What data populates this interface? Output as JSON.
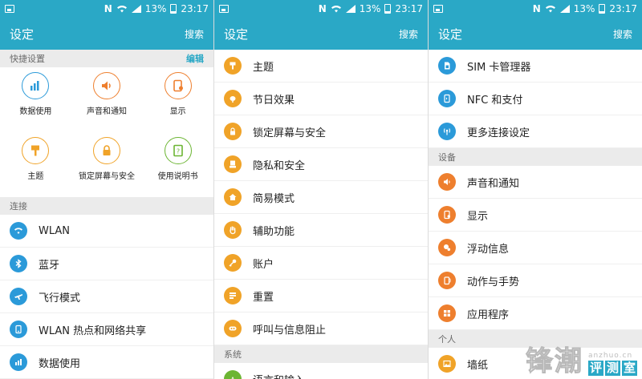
{
  "status": {
    "battery": "13%",
    "time": "23:17",
    "nfc": "N"
  },
  "header": {
    "title": "设定",
    "search": "搜索"
  },
  "panel1": {
    "quick_section": "快捷设置",
    "edit_label": "编辑",
    "quick": [
      {
        "label": "数据使用",
        "color": "#2b9ad9",
        "icon": "bar-chart-icon"
      },
      {
        "label": "声音和通知",
        "color": "#ee7f2e",
        "icon": "speaker-icon"
      },
      {
        "label": "显示",
        "color": "#ee7f2e",
        "icon": "display-icon"
      },
      {
        "label": "主题",
        "color": "#f0a328",
        "icon": "brush-icon"
      },
      {
        "label": "锁定屏幕与安全",
        "color": "#f0a328",
        "icon": "lock-icon"
      },
      {
        "label": "使用说明书",
        "color": "#6cb533",
        "icon": "book-icon"
      }
    ],
    "conn_section": "连接",
    "items": [
      {
        "label": "WLAN",
        "color": "#2b9ad9",
        "icon": "wifi-icon"
      },
      {
        "label": "蓝牙",
        "color": "#2b9ad9",
        "icon": "bluetooth-icon"
      },
      {
        "label": "飞行模式",
        "color": "#2b9ad9",
        "icon": "airplane-icon"
      },
      {
        "label": "WLAN 热点和网络共享",
        "color": "#2b9ad9",
        "icon": "hotspot-icon"
      },
      {
        "label": "数据使用",
        "color": "#2b9ad9",
        "icon": "bar-chart-icon"
      }
    ]
  },
  "panel2": {
    "items": [
      {
        "label": "主题",
        "color": "#f0a328",
        "icon": "brush-icon"
      },
      {
        "label": "节日效果",
        "color": "#f0a328",
        "icon": "lantern-icon"
      },
      {
        "label": "锁定屏幕与安全",
        "color": "#f0a328",
        "icon": "lock-icon"
      },
      {
        "label": "隐私和安全",
        "color": "#f0a328",
        "icon": "privacy-icon"
      },
      {
        "label": "简易模式",
        "color": "#f0a328",
        "icon": "home-icon"
      },
      {
        "label": "辅助功能",
        "color": "#f0a328",
        "icon": "hand-icon"
      },
      {
        "label": "账户",
        "color": "#f0a328",
        "icon": "key-icon"
      },
      {
        "label": "重置",
        "color": "#f0a328",
        "icon": "reset-icon"
      },
      {
        "label": "呼叫与信息阻止",
        "color": "#f0a328",
        "icon": "block-icon"
      }
    ],
    "system_section": "系统",
    "partial_item": {
      "label": "语言和输入",
      "color": "#6cb533",
      "icon": "language-icon"
    }
  },
  "panel3": {
    "items": [
      {
        "label": "SIM 卡管理器",
        "color": "#2b9ad9",
        "icon": "sim-icon"
      },
      {
        "label": "NFC 和支付",
        "color": "#2b9ad9",
        "icon": "nfc-icon"
      },
      {
        "label": "更多连接设定",
        "color": "#2b9ad9",
        "icon": "antenna-icon"
      }
    ],
    "device_section": "设备",
    "device_items": [
      {
        "label": "声音和通知",
        "color": "#ee7f2e",
        "icon": "speaker-icon"
      },
      {
        "label": "显示",
        "color": "#ee7f2e",
        "icon": "display-icon"
      },
      {
        "label": "浮动信息",
        "color": "#ee7f2e",
        "icon": "bubble-icon"
      },
      {
        "label": "动作与手势",
        "color": "#ee7f2e",
        "icon": "gesture-icon"
      },
      {
        "label": "应用程序",
        "color": "#ee7f2e",
        "icon": "apps-icon"
      }
    ],
    "personal_section": "个人",
    "partial_item": {
      "label": "墙纸",
      "color": "#f0a328",
      "icon": "wallpaper-icon"
    }
  },
  "watermark": {
    "big": "锋潮",
    "url": "anzhuo.cn",
    "box": [
      "评",
      "测",
      "室"
    ]
  }
}
